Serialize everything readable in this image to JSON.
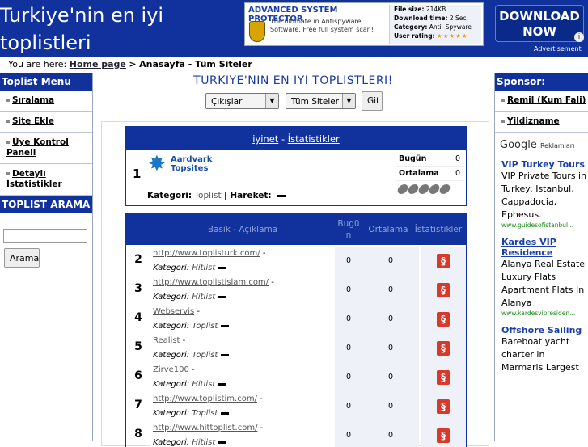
{
  "header": {
    "title_line1": "Turkiye'nin en iyi",
    "title_line2": "toplistleri",
    "ad": {
      "title": "ADVANCED SYSTEM PROTECTOR",
      "desc": "The ultimate in Antispyware Software. Free full system scan!",
      "file_size_label": "File size:",
      "file_size": "214KB",
      "download_time_label": "Download time:",
      "download_time": "2 Sec.",
      "category_label": "Category:",
      "category": "Anti- Spyware",
      "rating_label": "User rating:",
      "rating_stars": "★★★★★",
      "download_line1": "DOWNLOAD",
      "download_line2": "NOW",
      "info": "i",
      "ad_label": "Advertisement"
    }
  },
  "breadcrumb": {
    "prefix": "You are here:",
    "home": "Home page",
    "sep": ">",
    "current": "Anasayfa - Tüm Siteler"
  },
  "left_menu": {
    "heading": "Toplist Menu",
    "items": [
      {
        "label": "Sıralama"
      },
      {
        "label": "Site Ekle"
      },
      {
        "label": "Üye Kontrol Paneli"
      },
      {
        "label": "Detaylı İstatistikler"
      }
    ],
    "search_heading": "TOPLIST ARAMA",
    "search_value": "",
    "search_button": "Arama"
  },
  "main": {
    "title": "TURKIYE'NIN EN IYI TOPLISTLERI!",
    "select1": "Çıkışlar",
    "select2": "Tüm Siteler",
    "go_button": "Git",
    "featured": {
      "head_link1": "iyinet",
      "head_sep": "-",
      "head_link2": "İstatistikler",
      "rank": "1",
      "logo_line1": "Aardvark",
      "logo_line2": "Topsites",
      "kategori_label": "Kategori:",
      "kategori": "Toplist",
      "hareket_label": "| Hareket:",
      "bugun_label": "Bugün",
      "bugun": "0",
      "ortalama_label": "Ortalama",
      "ortalama": "0"
    },
    "list_head": {
      "basik": "Basik - Açıklama",
      "bugun": "Bugü n",
      "ortalama": "Ortalama",
      "istatistikler": "İstatistikler"
    },
    "rows": [
      {
        "rank": "2",
        "url": "http://www.toplisturk.com/",
        "cat": "Hitlist",
        "bugun": "0",
        "ortalama": "0"
      },
      {
        "rank": "3",
        "url": "http://www.toplistislam.com/",
        "cat": "Hitlist",
        "bugun": "0",
        "ortalama": "0"
      },
      {
        "rank": "4",
        "url": "Webservis",
        "cat": "Toplist",
        "bugun": "0",
        "ortalama": "0"
      },
      {
        "rank": "5",
        "url": "Realist",
        "cat": "Toplist",
        "bugun": "0",
        "ortalama": "0"
      },
      {
        "rank": "6",
        "url": "Zirve100",
        "cat": "Hitlist",
        "bugun": "0",
        "ortalama": "0"
      },
      {
        "rank": "7",
        "url": "http://www.toplistim.com/",
        "cat": "Toplist",
        "bugun": "0",
        "ortalama": "0"
      },
      {
        "rank": "8",
        "url": "http://www.hittoplist.com/",
        "cat": "Hitlist",
        "bugun": "0",
        "ortalama": "0"
      }
    ],
    "row_sep": "-",
    "kategori_label": "Kategori:"
  },
  "right": {
    "heading": "Sponsor:",
    "links": [
      {
        "label": "Remil (Kum Fali)"
      },
      {
        "label": "Yildizname"
      }
    ],
    "google_label": "Google",
    "google_small": "Reklamları",
    "ads": [
      {
        "title": "VIP Turkey Tours",
        "desc": "VIP Private Tours in Turkey: Istanbul, Cappadocia, Ephesus.",
        "url": "www.guidesofistanbul..."
      },
      {
        "title": "Kardes VIP Residence",
        "desc": "Alanya Real Estate Luxury Flats Apartment Flats In Alanya",
        "url": "www.kardesvipresiden..."
      },
      {
        "title": "Offshore Sailing",
        "desc": "Bareboat yacht charter in Marmaris Largest",
        "url": ""
      }
    ]
  }
}
